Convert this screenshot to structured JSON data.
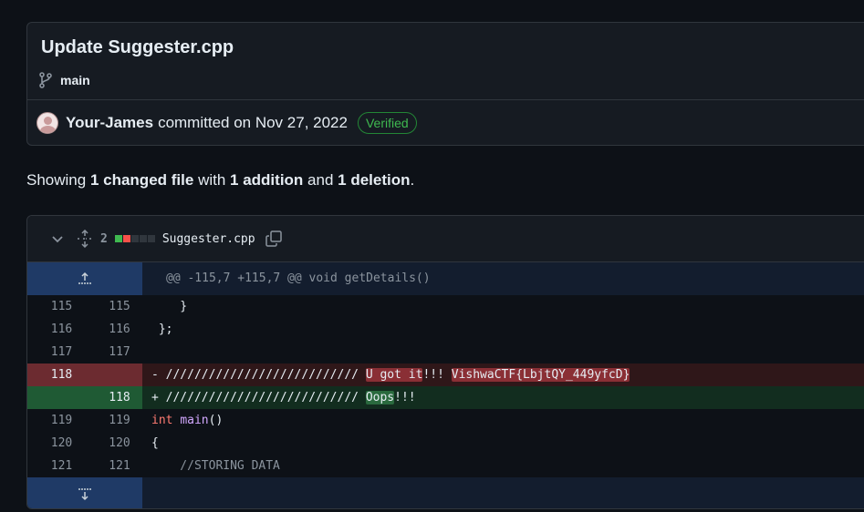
{
  "commit": {
    "title": "Update Suggester.cpp",
    "branch": "main",
    "author": "Your-James",
    "committed_text": "committed on Nov 27, 2022",
    "verified_label": "Verified"
  },
  "summary": {
    "prefix": "Showing",
    "files": "1 changed file",
    "with": "with",
    "additions": "1 addition",
    "and": "and",
    "deletions": "1 deletion",
    "suffix": "."
  },
  "file": {
    "change_count": "2",
    "name": "Suggester.cpp",
    "diffstat_colors": [
      "#3fb950",
      "#f85149",
      "#30363d",
      "#30363d",
      "#30363d"
    ]
  },
  "hunk_header": "@@ -115,7 +115,7 @@ void getDetails()",
  "lines": [
    {
      "old": "115",
      "new": "115",
      "code": "    }"
    },
    {
      "old": "116",
      "new": "116",
      "code": " };"
    },
    {
      "old": "117",
      "new": "117",
      "code": ""
    },
    {
      "old": "118",
      "new": "",
      "prefix": "- ",
      "comment": "/////////////////////////// ",
      "hl1": "U got it",
      "mid": "!!! ",
      "hl2": "VishwaCTF{LbjtQY_449yfcD}"
    },
    {
      "old": "",
      "new": "118",
      "prefix": "+ ",
      "comment": "/////////////////////////// ",
      "hl1": "Oops",
      "mid": "!!!"
    },
    {
      "old": "119",
      "new": "119",
      "kw": "int",
      "fn": "main",
      "rest": "()"
    },
    {
      "old": "120",
      "new": "120",
      "code": "{"
    },
    {
      "old": "121",
      "new": "121",
      "comment_line": "    //STORING DATA"
    }
  ]
}
